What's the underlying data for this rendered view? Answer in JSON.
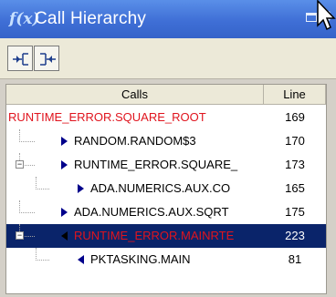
{
  "window": {
    "title": "Call Hierarchy",
    "app_icon_text": "f(x)"
  },
  "toolbar": {
    "buttons": [
      {
        "name": "show-callers",
        "tooltip": ""
      },
      {
        "name": "show-callees",
        "tooltip": ""
      }
    ]
  },
  "tree": {
    "headers": {
      "calls": "Calls",
      "line": "Line"
    },
    "rows": [
      {
        "call": "RUNTIME_ERROR.SQUARE_ROOT",
        "line": "169",
        "color": "#e0141e",
        "depth": 0,
        "marker": "none",
        "toggle": "none"
      },
      {
        "call": "RANDOM.RANDOM$3",
        "line": "170",
        "color": "#000000",
        "depth": 1,
        "marker": "right",
        "toggle": "none"
      },
      {
        "call": "RUNTIME_ERROR.SQUARE_",
        "line": "173",
        "color": "#000000",
        "depth": 1,
        "marker": "right",
        "toggle": "minus"
      },
      {
        "call": "ADA.NUMERICS.AUX.CO",
        "line": "165",
        "color": "#000000",
        "depth": 2,
        "marker": "right",
        "toggle": "none"
      },
      {
        "call": "ADA.NUMERICS.AUX.SQRT",
        "line": "175",
        "color": "#000000",
        "depth": 1,
        "marker": "right",
        "toggle": "none"
      },
      {
        "call": "RUNTIME_ERROR.MAINRTE",
        "line": "223",
        "color": "#e0141e",
        "depth": 1,
        "marker": "left",
        "toggle": "minus",
        "selected": true
      },
      {
        "call": "PKTASKING.MAIN",
        "line": "81",
        "color": "#000000",
        "depth": 2,
        "marker": "left",
        "toggle": "none"
      }
    ]
  },
  "colors": {
    "title_bar": "#3f6fd6",
    "selection": "#0a246a",
    "error_text": "#e0141e",
    "marker": "#00008b"
  }
}
